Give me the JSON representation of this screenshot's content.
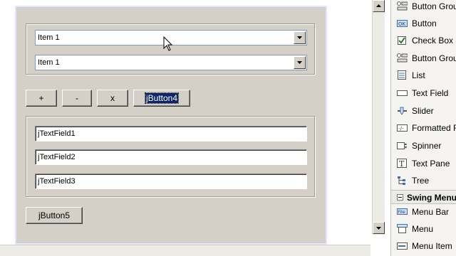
{
  "form": {
    "combo1_value": "Item 1",
    "combo2_value": "Item 1",
    "buttons": {
      "plus": "+",
      "minus": "-",
      "x": "x",
      "button4": "jButton4"
    },
    "text_fields": [
      "jTextField1",
      "jTextField2",
      "jTextField3"
    ],
    "button5": "jButton5"
  },
  "palette": {
    "items": [
      {
        "label": "Button Group",
        "icon": "button-group-icon"
      },
      {
        "label": "Button",
        "icon": "button-icon"
      },
      {
        "label": "Check Box",
        "icon": "checkbox-icon"
      },
      {
        "label": "Button Group",
        "icon": "button-group-icon"
      },
      {
        "label": "List",
        "icon": "list-icon"
      },
      {
        "label": "Text Field",
        "icon": "text-field-icon"
      },
      {
        "label": "Slider",
        "icon": "slider-icon"
      },
      {
        "label": "Formatted Field",
        "icon": "formatted-field-icon"
      },
      {
        "label": "Spinner",
        "icon": "spinner-icon"
      },
      {
        "label": "Text Pane",
        "icon": "text-pane-icon"
      },
      {
        "label": "Tree",
        "icon": "tree-icon"
      }
    ],
    "section": "Swing Menus",
    "menu_items": [
      {
        "label": "Menu Bar",
        "icon": "menu-bar-icon"
      },
      {
        "label": "Menu",
        "icon": "menu-icon"
      },
      {
        "label": "Menu Item",
        "icon": "menu-item-icon"
      }
    ]
  }
}
